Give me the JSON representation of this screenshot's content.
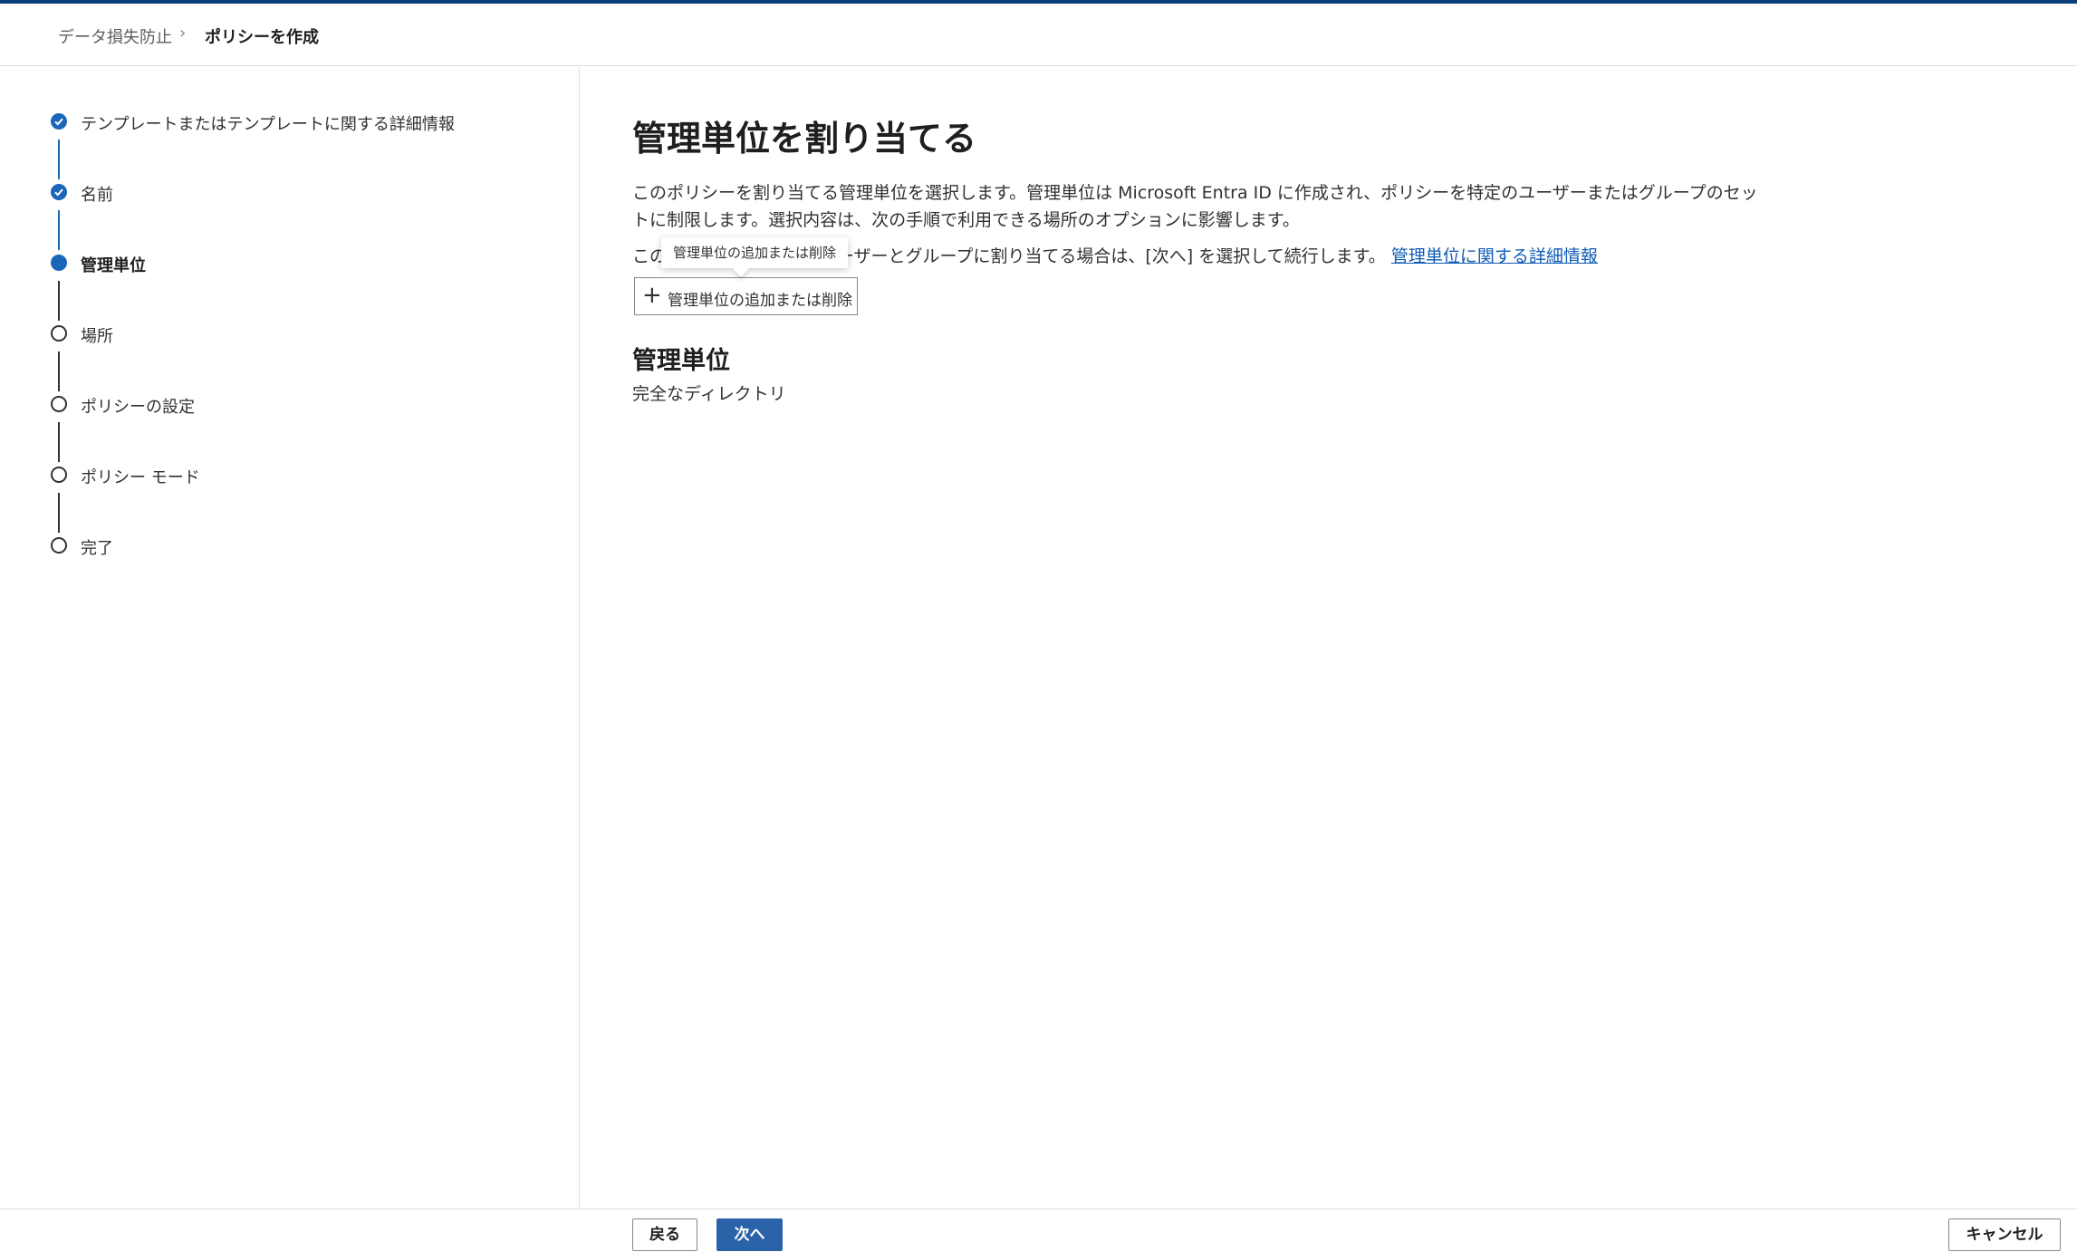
{
  "colors": {
    "accent": "#1a66b8",
    "primary_button": "#2b63a8",
    "top_bar": "#0b3d7a",
    "link": "#0f5bb5"
  },
  "breadcrumb": {
    "items": [
      "データ損失防止",
      "ポリシーを作成"
    ],
    "separator": "›"
  },
  "steps": [
    {
      "label": "テンプレートまたはテンプレートに関する詳細情報",
      "status": "completed"
    },
    {
      "label": "名前",
      "status": "completed"
    },
    {
      "label": "管理単位",
      "status": "current"
    },
    {
      "label": "場所",
      "status": "not-started"
    },
    {
      "label": "ポリシーの設定",
      "status": "not-started"
    },
    {
      "label": "ポリシー モード",
      "status": "not-started"
    },
    {
      "label": "完了",
      "status": "not-started"
    }
  ],
  "main": {
    "title": "管理単位を割り当てる",
    "description_1": "このポリシーを割り当てる管理単位を選択します。管理単位は Microsoft Entra ID に作成され、ポリシーを特定のユーザーまたはグループのセットに制限します。選択内容は、次の手順で利用できる場所のオプションに影響します。",
    "description_2": "このポリシーをすべてのユーザーとグループに割り当てる場合は、[次へ] を選択して続行します。",
    "learn_more_link": "管理単位に関する詳細情報",
    "add_button_label": "管理単位の追加または削除",
    "tooltip_text": "管理単位の追加または削除",
    "section_heading": "管理単位",
    "section_value": "完全なディレクトリ"
  },
  "footer": {
    "back_label": "戻る",
    "next_label": "次へ",
    "cancel_label": "キャンセル"
  }
}
